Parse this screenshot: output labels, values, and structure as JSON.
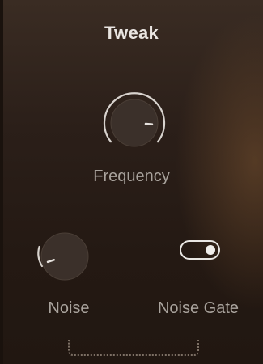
{
  "panel": {
    "title": "Tweak"
  },
  "controls": {
    "frequency": {
      "label": "Frequency",
      "type": "knob",
      "value": 0.85
    },
    "noise": {
      "label": "Noise",
      "type": "knob",
      "value": 0.1
    },
    "noise_gate": {
      "label": "Noise Gate",
      "type": "toggle",
      "state": "on"
    }
  },
  "icons": {
    "drop_zone": "dotted-bracket"
  },
  "colors": {
    "background": "#2a1d16",
    "title": "#e9e5e1",
    "label": "#a9a39d",
    "knob_fill": "#3b302a",
    "knob_ring": "#d8d3ce",
    "toggle": "#e8e6e3"
  }
}
